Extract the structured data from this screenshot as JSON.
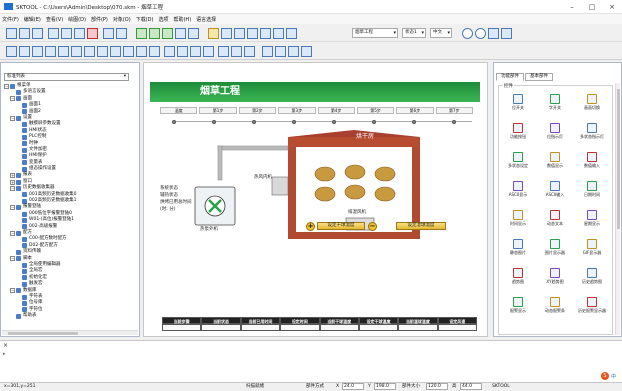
{
  "window": {
    "title": "SKTOOL - C:\\Users\\Admin\\Desktop\\070.skm - 烟草工程"
  },
  "menu": [
    "文件(F)",
    "编辑(E)",
    "查看(V)",
    "绘图(D)",
    "部件(P)",
    "对象(O)",
    "下载(D)",
    "选项",
    "帮助(H)",
    "语言选择"
  ],
  "toolbar": {
    "combo1": "烟草工程",
    "combo2": "状态1",
    "combo3": "中文"
  },
  "left_panel": {
    "header": "工程管理器",
    "combo": "标准列表",
    "tree": [
      {
        "label": "根菜单",
        "level": 0,
        "toggle": "−"
      },
      {
        "label": "多语言设置",
        "level": 1,
        "toggle": ""
      },
      {
        "label": "画面",
        "level": 1,
        "toggle": "−"
      },
      {
        "label": "画面1",
        "level": 2,
        "toggle": ""
      },
      {
        "label": "画面2",
        "level": 2,
        "toggle": ""
      },
      {
        "label": "设置",
        "level": 1,
        "toggle": "−"
      },
      {
        "label": "触摸屏参数设置",
        "level": 2,
        "toggle": ""
      },
      {
        "label": "HMI状态",
        "level": 2,
        "toggle": ""
      },
      {
        "label": "PLC控制",
        "level": 2,
        "toggle": ""
      },
      {
        "label": "时钟",
        "level": 2,
        "toggle": ""
      },
      {
        "label": "文件加密",
        "level": 2,
        "toggle": ""
      },
      {
        "label": "HMI保护",
        "level": 2,
        "toggle": ""
      },
      {
        "label": "变量表",
        "level": 2,
        "toggle": ""
      },
      {
        "label": "组态操作设置",
        "level": 2,
        "toggle": ""
      },
      {
        "label": "报表",
        "level": 1,
        "toggle": "+"
      },
      {
        "label": "窗口",
        "level": 1,
        "toggle": "+"
      },
      {
        "label": "历史数据收集器",
        "level": 1,
        "toggle": "−"
      },
      {
        "label": "001高频历史数据收集0",
        "level": 2,
        "toggle": ""
      },
      {
        "label": "002高频历史数据收集1",
        "level": 2,
        "toggle": ""
      },
      {
        "label": "报警登陆",
        "level": 1,
        "toggle": "−"
      },
      {
        "label": "000低位字报警登陆0",
        "level": 2,
        "toggle": ""
      },
      {
        "label": "W01-(高位)报警登陆1",
        "level": 2,
        "toggle": ""
      },
      {
        "label": "002-高级报警",
        "level": 2,
        "toggle": ""
      },
      {
        "label": "配方",
        "level": 1,
        "toggle": "−"
      },
      {
        "label": "C00-配方数时配方",
        "level": 2,
        "toggle": ""
      },
      {
        "label": "D02-配方配方",
        "level": 2,
        "toggle": ""
      },
      {
        "label": "资料传输",
        "level": 1,
        "toggle": ""
      },
      {
        "label": "脚本",
        "level": 1,
        "toggle": "−"
      },
      {
        "label": "全局使用编辑器",
        "level": 2,
        "toggle": ""
      },
      {
        "label": "全局宏",
        "level": 2,
        "toggle": ""
      },
      {
        "label": "初始化宏",
        "level": 2,
        "toggle": ""
      },
      {
        "label": "触发宏",
        "level": 2,
        "toggle": ""
      },
      {
        "label": "数据库",
        "level": 1,
        "toggle": "−"
      },
      {
        "label": "字符表",
        "level": 2,
        "toggle": ""
      },
      {
        "label": "位号库",
        "level": 2,
        "toggle": ""
      },
      {
        "label": "字符位",
        "level": 2,
        "toggle": ""
      },
      {
        "label": "帮助表",
        "level": 1,
        "toggle": ""
      }
    ]
  },
  "hmi": {
    "title": "烟草工程",
    "steps": [
      "温度",
      "第1步",
      "第2步",
      "第3步",
      "第4步",
      "第5步",
      "第6步",
      "第7步"
    ],
    "room_label": "烘干房",
    "hot_air_label": "热风内机",
    "exhaust_label": "排湿风机",
    "outer_unit_label": "热泵外机",
    "status_lines": [
      "系统状态",
      "辅热状态",
      "烘烤已用总时间",
      "(时: 分)"
    ],
    "btn_set_temp": "设定干球温度",
    "btn_set_humidity": "设定湿球温度",
    "table_headers": [
      "当前步骤",
      "当前状态",
      "当前已用时间",
      "设定时间",
      "当前干球温度",
      "设定干球温度",
      "当前湿球温度",
      "设定风速"
    ]
  },
  "right_panel": {
    "header": "工具箱",
    "tabs": [
      "功能部件",
      "基本部件"
    ],
    "group": "控件",
    "items": [
      "位开关",
      "字开关",
      "画面切换",
      "功能按钮",
      "位指示灯",
      "多状态指示灯",
      "多状态设定",
      "数值显示",
      "数值输入",
      "ASCII显示",
      "ASCII输入",
      "日期时间",
      "时间显示",
      "动态文本",
      "星期显示",
      "静态图片",
      "图片显示器",
      "GIF显示器",
      "趋势图",
      "XY趋势图",
      "历史趋势图",
      "报警显示",
      "动态报警条",
      "历史报警显示器"
    ]
  },
  "status": {
    "coords": "x=301,y=251",
    "state": "扫描就绪",
    "pos_label": "部件方式",
    "x_label": "X",
    "x_val": "24.0",
    "y_label": "Y",
    "y_val": "198.0",
    "w_label": "部件大小",
    "w_val": "120.0",
    "h_label": "高",
    "h_val": "44.0",
    "app": "SKTOOL"
  },
  "tray": {
    "label": "中"
  }
}
